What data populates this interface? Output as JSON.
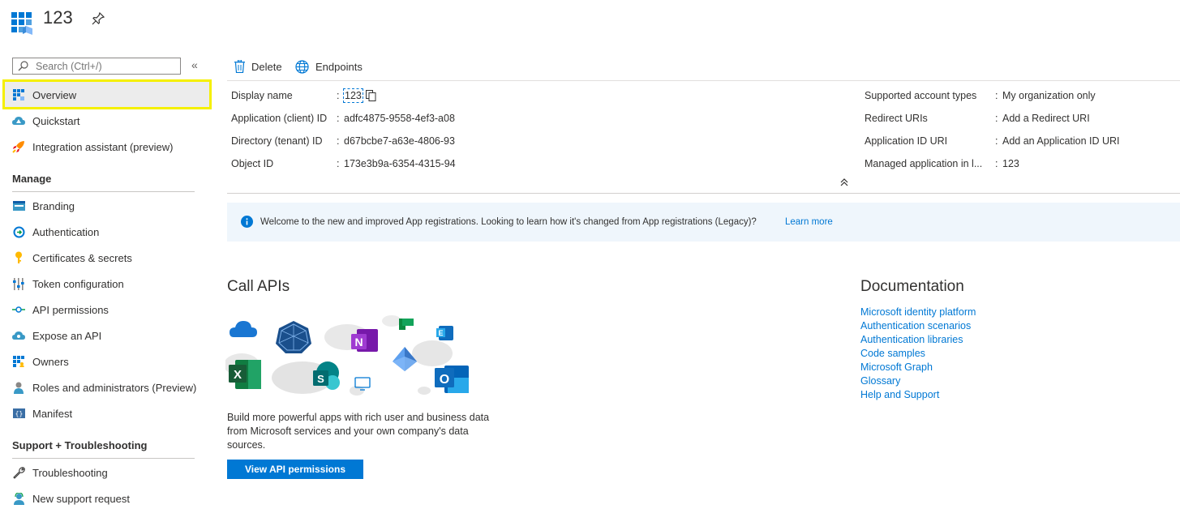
{
  "header": {
    "title": "123",
    "pin_icon": "pin-icon",
    "app_icon": "app-registration-icon"
  },
  "sidebar": {
    "search_placeholder": "Search (Ctrl+/)",
    "collapse_label": "«",
    "top_items": [
      {
        "label": "Overview",
        "icon": "overview-icon"
      },
      {
        "label": "Quickstart",
        "icon": "quickstart-icon"
      },
      {
        "label": "Integration assistant (preview)",
        "icon": "rocket-icon"
      }
    ],
    "manage_title": "Manage",
    "manage_items": [
      {
        "label": "Branding",
        "icon": "branding-icon"
      },
      {
        "label": "Authentication",
        "icon": "authentication-icon"
      },
      {
        "label": "Certificates & secrets",
        "icon": "key-icon"
      },
      {
        "label": "Token configuration",
        "icon": "token-icon"
      },
      {
        "label": "API permissions",
        "icon": "api-permissions-icon"
      },
      {
        "label": "Expose an API",
        "icon": "expose-api-icon"
      },
      {
        "label": "Owners",
        "icon": "owners-icon"
      },
      {
        "label": "Roles and administrators (Preview)",
        "icon": "roles-icon"
      },
      {
        "label": "Manifest",
        "icon": "manifest-icon"
      }
    ],
    "support_title": "Support + Troubleshooting",
    "support_items": [
      {
        "label": "Troubleshooting",
        "icon": "wrench-icon"
      },
      {
        "label": "New support request",
        "icon": "support-icon"
      }
    ]
  },
  "toolbar": {
    "delete_label": "Delete",
    "endpoints_label": "Endpoints"
  },
  "essentials": {
    "left": [
      {
        "label": "Display name",
        "value": "123"
      },
      {
        "label": "Application (client) ID",
        "value": "adfc4875-9558-4ef3-a08"
      },
      {
        "label": "Directory (tenant) ID",
        "value": "d67bcbe7-a63e-4806-93"
      },
      {
        "label": "Object ID",
        "value": "173e3b9a-6354-4315-94"
      }
    ],
    "right": [
      {
        "label": "Supported account types",
        "value": "My organization only"
      },
      {
        "label": "Redirect URIs",
        "value": "Add a Redirect URI"
      },
      {
        "label": "Application ID URI",
        "value": "Add an Application ID URI"
      },
      {
        "label": "Managed application in l...",
        "value": "123"
      }
    ],
    "colon": ":"
  },
  "banner": {
    "text": "Welcome to the new and improved App registrations. Looking to learn how it's changed from App registrations (Legacy)?",
    "link": "Learn more"
  },
  "call_apis": {
    "title": "Call APIs",
    "description": "Build more powerful apps with rich user and business data from Microsoft services and your own company's data sources.",
    "button": "View API permissions"
  },
  "documentation": {
    "title": "Documentation",
    "links": [
      "Microsoft identity platform",
      "Authentication scenarios",
      "Authentication libraries",
      "Code samples",
      "Microsoft Graph",
      "Glossary",
      "Help and Support"
    ]
  },
  "colors": {
    "accent": "#0078d4",
    "highlight": "#f5f000",
    "banner_bg": "#eff6fc"
  }
}
